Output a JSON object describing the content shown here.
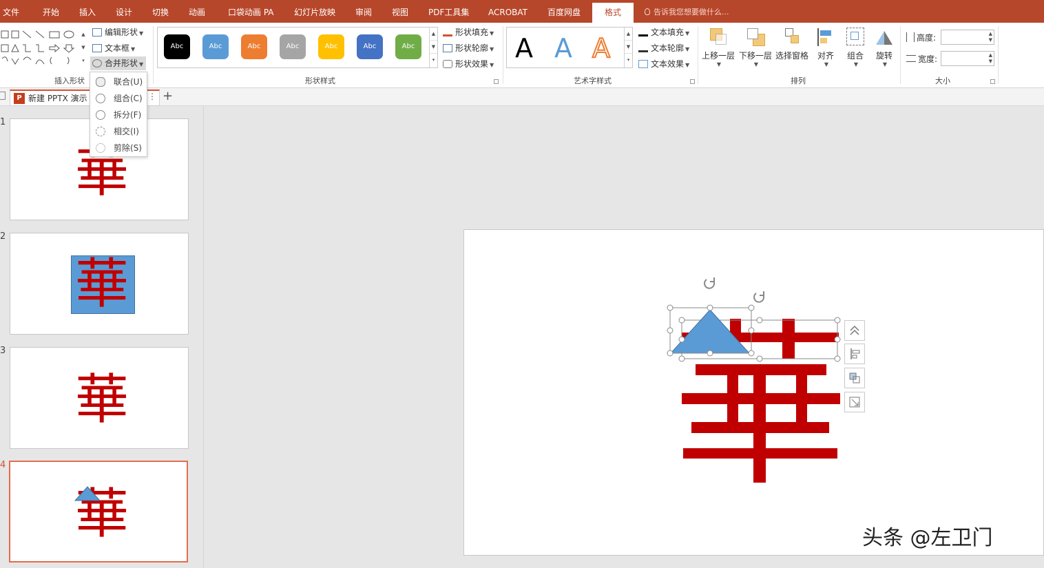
{
  "tabs": [
    {
      "label": "文件"
    },
    {
      "label": "开始"
    },
    {
      "label": "插入"
    },
    {
      "label": "设计"
    },
    {
      "label": "切换"
    },
    {
      "label": "动画"
    },
    {
      "label": "口袋动画 PA"
    },
    {
      "label": "幻灯片放映"
    },
    {
      "label": "审阅"
    },
    {
      "label": "视图"
    },
    {
      "label": "PDF工具集"
    },
    {
      "label": "ACROBAT"
    },
    {
      "label": "百度网盘"
    },
    {
      "label": "格式"
    }
  ],
  "tell_me": "告诉我您想要做什么...",
  "ribbon": {
    "insert_shapes": {
      "label": "插入形状",
      "edit_shape": "编辑形状",
      "text_box": "文本框",
      "merge_shapes": "合并形状"
    },
    "shape_styles": {
      "label": "形状样式",
      "swatches": [
        {
          "text": "Abc",
          "color": "#000000"
        },
        {
          "text": "Abc",
          "color": "#5b9bd5"
        },
        {
          "text": "Abc",
          "color": "#ed7d31"
        },
        {
          "text": "Abc",
          "color": "#a5a5a5"
        },
        {
          "text": "Abc",
          "color": "#ffc000"
        },
        {
          "text": "Abc",
          "color": "#4472c4"
        },
        {
          "text": "Abc",
          "color": "#70ad47"
        }
      ],
      "fill": "形状填充",
      "outline": "形状轮廓",
      "effects": "形状效果"
    },
    "wordart": {
      "label": "艺术字样式",
      "samples": [
        "A",
        "A",
        "A"
      ],
      "fill": "文本填充",
      "outline": "文本轮廓",
      "effects": "文本效果"
    },
    "arrange": {
      "label": "排列",
      "bring_forward": "上移一层",
      "send_backward": "下移一层",
      "selection_pane": "选择窗格",
      "align": "对齐",
      "group": "组合",
      "rotate": "旋转"
    },
    "size": {
      "label": "大小",
      "height_label": "高度:",
      "width_label": "宽度:",
      "height_value": "",
      "width_value": ""
    }
  },
  "merge_menu": [
    {
      "label": "联合(U)",
      "icon": "union-icon"
    },
    {
      "label": "组合(C)",
      "icon": "combine-icon"
    },
    {
      "label": "拆分(F)",
      "icon": "fragment-icon"
    },
    {
      "label": "相交(I)",
      "icon": "intersect-icon"
    },
    {
      "label": "剪除(S)",
      "icon": "subtract-icon"
    }
  ],
  "document": {
    "tab_title": "新建 PPTX 演示",
    "app_icon_text": "P"
  },
  "slides": [
    {
      "number": "1",
      "char": "華"
    },
    {
      "number": "2",
      "char": "華"
    },
    {
      "number": "3",
      "char": "華"
    },
    {
      "number": "4",
      "char": "華"
    }
  ],
  "watermark": "头条 @左卫门",
  "colors": {
    "accent": "#b7472a",
    "character_red": "#c00000",
    "shape_blue": "#5b9bd5",
    "thumb_selected": "#e46c4b"
  }
}
